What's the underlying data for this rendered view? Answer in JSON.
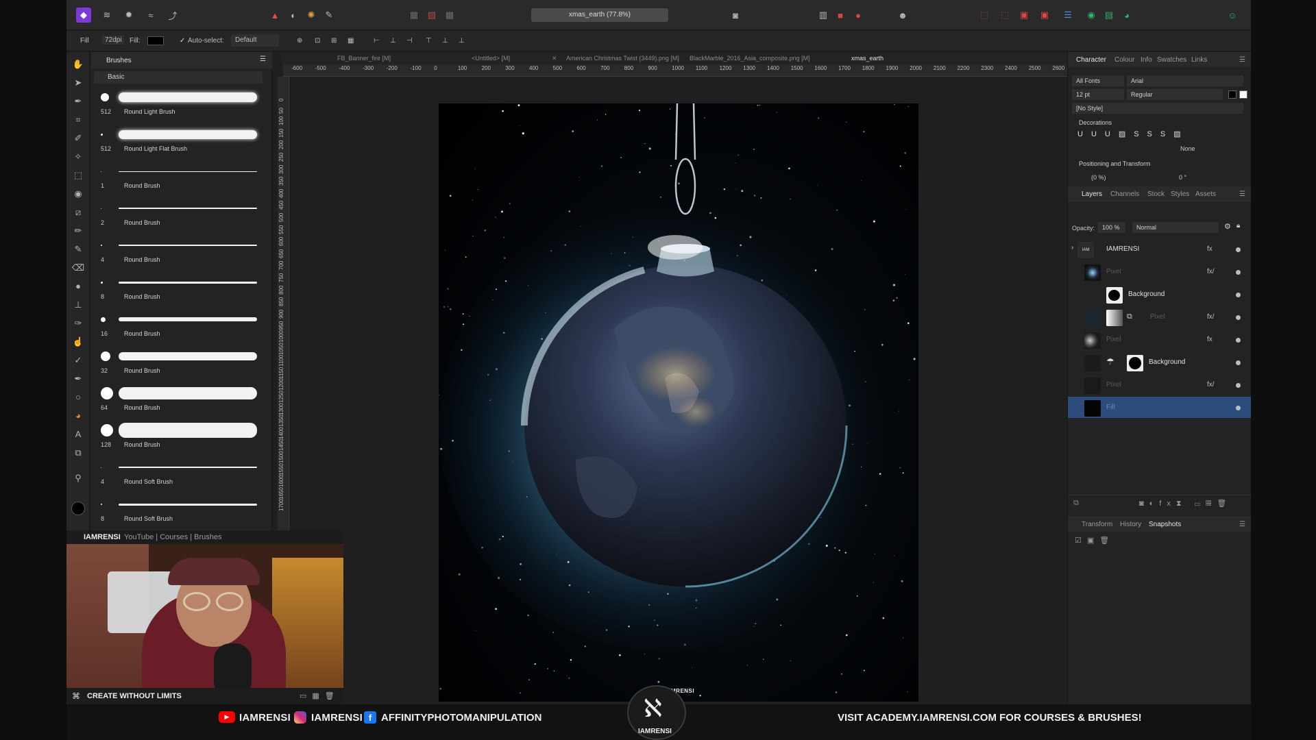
{
  "document": {
    "title": "xmas_earth (77.8%)"
  },
  "context_toolbar": {
    "mode": "Fill",
    "dpi": "72dpi",
    "fill_label": "Fill:",
    "autoselect_label": "Auto-select:",
    "autoselect_value": "Default"
  },
  "brushes": {
    "panel_title": "Brushes",
    "category": "Basic",
    "items": [
      {
        "size": "512",
        "name": "Round Light Brush"
      },
      {
        "size": "512",
        "name": "Round Light Flat Brush"
      },
      {
        "size": "1",
        "name": "Round Brush"
      },
      {
        "size": "2",
        "name": "Round Brush"
      },
      {
        "size": "4",
        "name": "Round Brush"
      },
      {
        "size": "8",
        "name": "Round Brush"
      },
      {
        "size": "16",
        "name": "Round Brush"
      },
      {
        "size": "32",
        "name": "Round Brush"
      },
      {
        "size": "64",
        "name": "Round Brush"
      },
      {
        "size": "128",
        "name": "Round Brush"
      },
      {
        "size": "4",
        "name": "Round Soft Brush"
      },
      {
        "size": "8",
        "name": "Round Soft Brush"
      }
    ]
  },
  "tabs": [
    {
      "label": "FB_Banner_fire [M]"
    },
    {
      "label": "<Untitled> [M]"
    },
    {
      "label": "American Christmas Twist (3449).png [M]"
    },
    {
      "label": "BlackMarble_2016_Asia_composite.png [M]"
    },
    {
      "label": "xmas_earth"
    }
  ],
  "ruler": {
    "h": [
      "-600",
      "-500",
      "-400",
      "-300",
      "-200",
      "-100",
      "0",
      "100",
      "200",
      "300",
      "400",
      "500",
      "600",
      "700",
      "800",
      "900",
      "1000",
      "1100",
      "1200",
      "1300",
      "1400",
      "1500",
      "1600",
      "1700",
      "1800",
      "1900",
      "2000",
      "2100",
      "2200",
      "2300",
      "2400",
      "2500",
      "2600"
    ],
    "v": [
      "0",
      "50",
      "100",
      "150",
      "200",
      "250",
      "300",
      "350",
      "400",
      "450",
      "500",
      "550",
      "600",
      "650",
      "700",
      "750",
      "800",
      "850",
      "900",
      "950",
      "1000",
      "1050",
      "1100",
      "1150",
      "1200",
      "1250",
      "1300",
      "1350",
      "1400",
      "1450",
      "1500",
      "1550",
      "1600",
      "1650",
      "1700"
    ]
  },
  "canvas": {
    "watermark": "IAMRENSI"
  },
  "character": {
    "tabs": [
      "Character",
      "Colour",
      "Info",
      "Swatches",
      "Links"
    ],
    "font_collection": "All Fonts",
    "font_family": "Arial",
    "font_size": "12 pt",
    "font_style": "Regular",
    "style": "[No Style]",
    "decorations_label": "Decorations",
    "decorations_none": "None",
    "positioning_label": "Positioning and Transform",
    "baseline": "(0 %)",
    "skew": "0 °"
  },
  "layers_panel": {
    "tabs": [
      "Layers",
      "Channels",
      "Stock",
      "Styles",
      "Assets"
    ],
    "opacity_label": "Opacity:",
    "opacity_value": "100 %",
    "blend_mode": "Normal",
    "layers": [
      {
        "name": "IAMRENSI",
        "fx": "fx"
      },
      {
        "name": "Pixel",
        "fx": "fx/"
      },
      {
        "name": "Background",
        "fx": ""
      },
      {
        "name": "Pixel",
        "fx": "fx/"
      },
      {
        "name": "Pixel",
        "fx": "fx"
      },
      {
        "name": "Background",
        "fx": ""
      },
      {
        "name": "Pixel",
        "fx": "fx/"
      },
      {
        "name": "Fill",
        "fx": ""
      }
    ]
  },
  "bottom_panel": {
    "tabs": [
      "Transform",
      "History",
      "Snapshots"
    ]
  },
  "webcam": {
    "bar_brand": "IAMRENSI",
    "bar_links": "YouTube | Courses | Brushes",
    "tagline": "CREATE WITHOUT LIMITS"
  },
  "footer": {
    "youtube": "IAMRENSI",
    "instagram": "IAMRENSI",
    "facebook": "AFFINITYPHOTOMANIPULATION",
    "logo_text": "IAMRENSI",
    "cta": "VISIT ACADEMY.IAMRENSI.COM FOR COURSES & BRUSHES!"
  },
  "colors": {
    "accent": "#2b4d7a",
    "selected_layer": "#2c4c7c",
    "glow": "#7fd0ff",
    "youtube": "#ff0000",
    "instagram": "#d62976",
    "facebook": "#1877f2"
  }
}
